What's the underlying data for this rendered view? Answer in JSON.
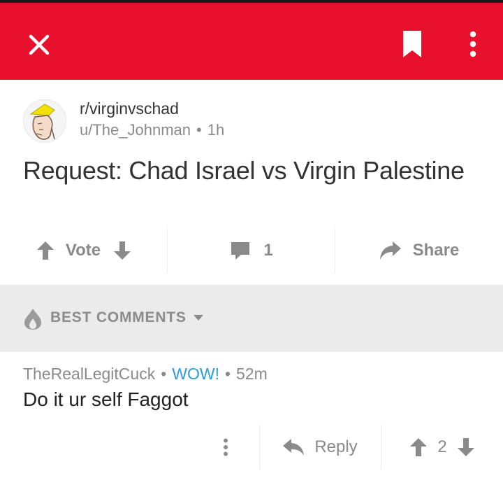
{
  "header": {
    "close_icon": "close-icon",
    "bookmark_icon": "bookmark-icon",
    "more_icon": "more-vertical-icon",
    "background_color": "#e8102d"
  },
  "post": {
    "subreddit": "r/virginvschad",
    "author": "u/The_Johnman",
    "age": "1h",
    "title": "Request: Chad Israel vs Virgin Palestine",
    "vote_label": "Vote",
    "comment_count": "1",
    "share_label": "Share"
  },
  "sort": {
    "label": "BEST COMMENTS",
    "icon": "flame-icon"
  },
  "comment": {
    "author": "TheRealLegitCuck",
    "flair": "WOW!",
    "age": "52m",
    "body": "Do it ur self Faggot",
    "reply_label": "Reply",
    "score": "2",
    "flair_color": "#2b9cd8"
  }
}
